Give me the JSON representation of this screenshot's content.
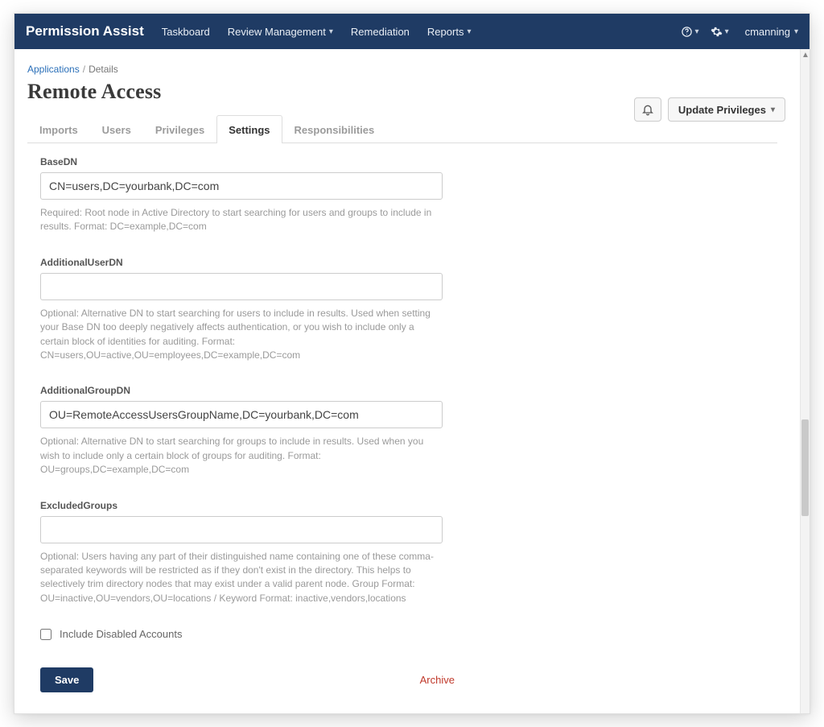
{
  "brand": "Permission Assist",
  "nav": {
    "items": [
      {
        "label": "Taskboard",
        "caret": false
      },
      {
        "label": "Review Management",
        "caret": true
      },
      {
        "label": "Remediation",
        "caret": false
      },
      {
        "label": "Reports",
        "caret": true
      }
    ],
    "user": "cmanning"
  },
  "breadcrumb": {
    "root": "Applications",
    "current": "Details"
  },
  "page_title": "Remote Access",
  "actions": {
    "update_label": "Update Privileges"
  },
  "tabs": [
    {
      "label": "Imports",
      "active": false
    },
    {
      "label": "Users",
      "active": false
    },
    {
      "label": "Privileges",
      "active": false
    },
    {
      "label": "Settings",
      "active": true
    },
    {
      "label": "Responsibilities",
      "active": false
    }
  ],
  "form": {
    "baseDN": {
      "label": "BaseDN",
      "value": "CN=users,DC=yourbank,DC=com",
      "help": "Required: Root node in Active Directory to start searching for users and groups to include in results. Format: DC=example,DC=com"
    },
    "additionalUserDN": {
      "label": "AdditionalUserDN",
      "value": "",
      "help": "Optional: Alternative DN to start searching for users to include in results. Used when setting your Base DN too deeply negatively affects authentication, or you wish to include only a certain block of identities for auditing. Format: CN=users,OU=active,OU=employees,DC=example,DC=com"
    },
    "additionalGroupDN": {
      "label": "AdditionalGroupDN",
      "value": "OU=RemoteAccessUsersGroupName,DC=yourbank,DC=com",
      "help": "Optional: Alternative DN to start searching for groups to include in results. Used when you wish to include only a certain block of groups for auditing. Format: OU=groups,DC=example,DC=com"
    },
    "excludedGroups": {
      "label": "ExcludedGroups",
      "value": "",
      "help": "Optional: Users having any part of their distinguished name containing one of these comma-separated keywords will be restricted as if they don't exist in the directory. This helps to selectively trim directory nodes that may exist under a valid parent node. Group Format: OU=inactive,OU=vendors,OU=locations / Keyword Format: inactive,vendors,locations"
    },
    "includeDisabled": {
      "label": "Include Disabled Accounts",
      "checked": false
    }
  },
  "footer": {
    "save": "Save",
    "archive": "Archive"
  }
}
